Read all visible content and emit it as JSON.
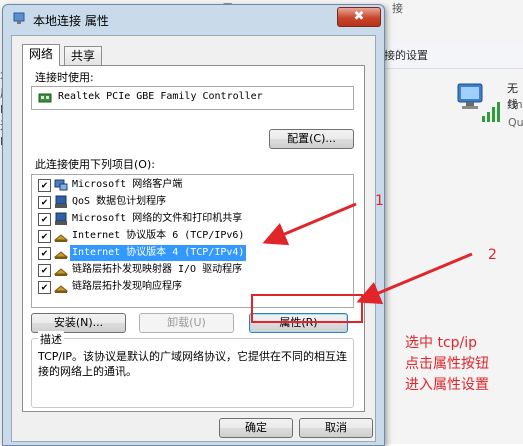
{
  "background": {
    "top_texts": [
      "属",
      "接"
    ],
    "toolbar_text": "接的设置",
    "left_strip": [
      "不",
      "局",
      "R",
      "无",
      "L"
    ],
    "network_title": "无线",
    "network_sub1": "fm",
    "network_sub2": "Qu"
  },
  "dialog": {
    "title": "本地连接 属性",
    "close_glyph": "✖",
    "tabs": [
      {
        "label": "网络",
        "active": true
      },
      {
        "label": "共享",
        "active": false
      }
    ],
    "connect_using_label": "连接时使用:",
    "adapter_name": "Realtek PCIe GBE Family Controller",
    "configure_button": "配置(C)...",
    "items_label": "此连接使用下列项目(O):",
    "items": [
      {
        "label": "Microsoft 网络客户端",
        "checked": true,
        "selected": false,
        "icon": "network-client-icon"
      },
      {
        "label": "QoS 数据包计划程序",
        "checked": true,
        "selected": false,
        "icon": "service-icon"
      },
      {
        "label": "Microsoft 网络的文件和打印机共享",
        "checked": true,
        "selected": false,
        "icon": "service-icon"
      },
      {
        "label": "Internet 协议版本 6 (TCP/IPv6)",
        "checked": true,
        "selected": false,
        "icon": "protocol-icon"
      },
      {
        "label": "Internet 协议版本 4 (TCP/IPv4)",
        "checked": true,
        "selected": true,
        "icon": "protocol-icon"
      },
      {
        "label": "链路层拓扑发现映射器 I/O 驱动程序",
        "checked": true,
        "selected": false,
        "icon": "protocol-icon"
      },
      {
        "label": "链路层拓扑发现响应程序",
        "checked": true,
        "selected": false,
        "icon": "protocol-icon"
      }
    ],
    "install_button": "安装(N)...",
    "uninstall_button": "卸载(U)",
    "properties_button": "属性(R)",
    "description_title": "描述",
    "description_text": "TCP/IP。该协议是默认的广域网络协议，它提供在不同的相互连接的网络上的通讯。",
    "ok_button": "确定",
    "cancel_button": "取消"
  },
  "annotations": {
    "marker1": "1",
    "marker2": "2",
    "note_lines": [
      "选中 tcp/ip",
      "点击属性按钮",
      "进入属性设置"
    ],
    "color": "#e0262b"
  },
  "colors": {
    "selection": "#3399ff",
    "titlebar": "#c9daea",
    "close": "#c8452c"
  }
}
